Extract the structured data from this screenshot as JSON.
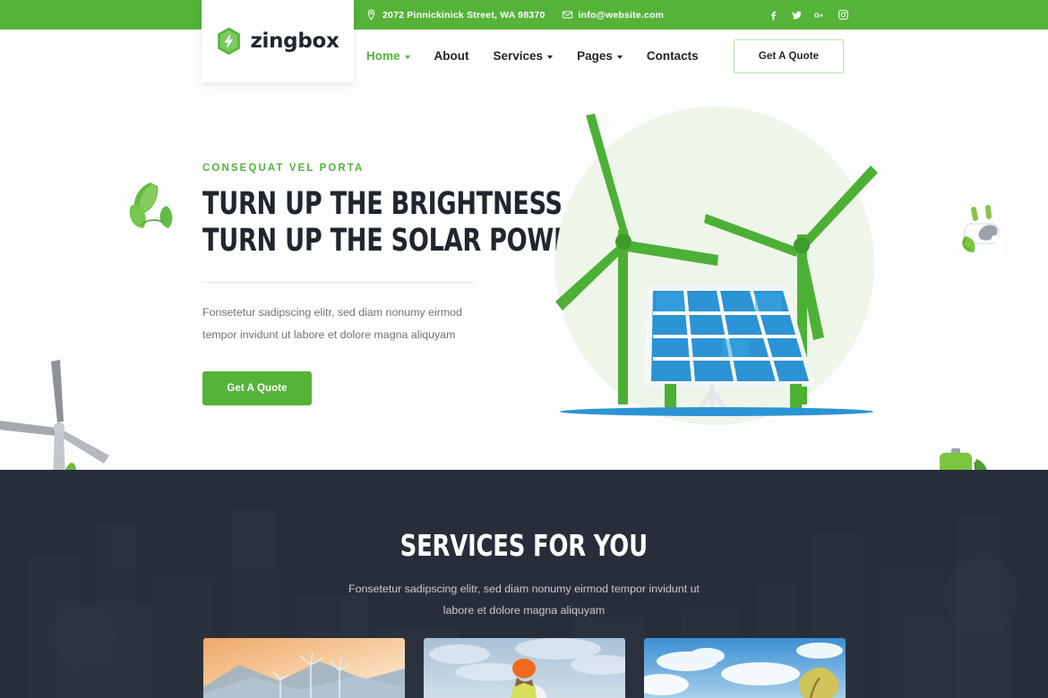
{
  "topbar": {
    "address": "2072 Pinnickinick Street, WA 98370",
    "email": "info@website.com",
    "location_icon": "map-pin-icon",
    "mail_icon": "envelope-icon",
    "social": [
      {
        "name": "facebook",
        "glyph": "f"
      },
      {
        "name": "twitter",
        "glyph": "t"
      },
      {
        "name": "google-plus",
        "glyph": "G+"
      },
      {
        "name": "instagram",
        "glyph": "ig"
      }
    ],
    "bg_color": "#55b33a"
  },
  "header": {
    "logo_text": "zingbox",
    "logo_icon": "hexagon-bolt-icon",
    "nav": [
      {
        "label": "Home",
        "active": true,
        "has_dropdown": true
      },
      {
        "label": "About",
        "active": false,
        "has_dropdown": false
      },
      {
        "label": "Services",
        "active": false,
        "has_dropdown": true
      },
      {
        "label": "Pages",
        "active": false,
        "has_dropdown": true
      },
      {
        "label": "Contacts",
        "active": false,
        "has_dropdown": false
      }
    ],
    "cta_label": "Get A Quote"
  },
  "hero": {
    "eyebrow": "CONSEQUAT VEL PORTA",
    "title_line1": "TURN UP THE BRIGHTNESS",
    "title_line2": "TURN UP THE SOLAR POWER.",
    "paragraph": "Fonsetetur sadipscing elitr, sed diam nonumy eirmod tempor invidunt ut labore et dolore magna aliquyam",
    "cta_label": "Get A Quote",
    "accent_color": "#55b33a",
    "title_color": "#20262e",
    "illustration": "wind-turbines-and-solar-panel-illustration",
    "decorations": [
      "leaves-icon",
      "wind-turbine-gray-icon",
      "electric-plug-leaf-icon",
      "eco-battery-recycle-icon"
    ]
  },
  "services": {
    "title": "SERVICES FOR YOU",
    "subtitle_line1": "Fonsetetur sadipscing elitr, sed diam nonumy eirmod tempor invidunt ut",
    "subtitle_line2": "labore et dolore magna aliquyam",
    "bg_color": "#272e39",
    "cards": [
      {
        "image": "wind-turbines-at-sunset-photo"
      },
      {
        "image": "worker-in-orange-helmet-photo"
      },
      {
        "image": "blue-sky-with-tree-photo"
      }
    ]
  }
}
